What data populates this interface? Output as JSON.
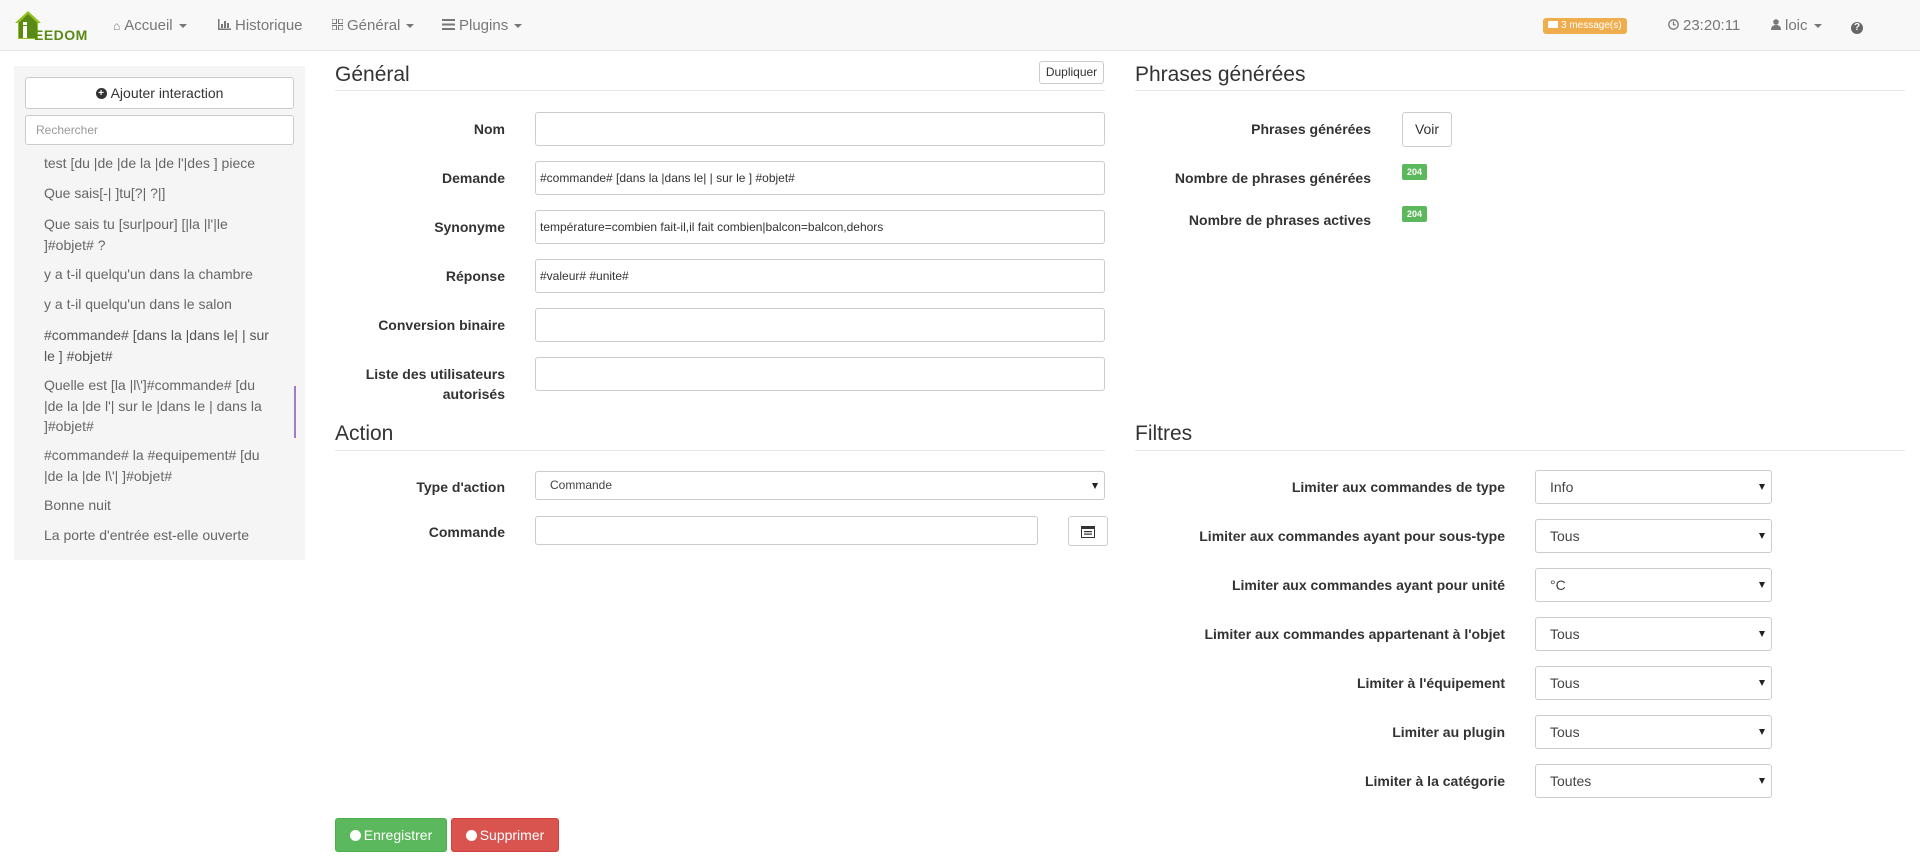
{
  "navbar": {
    "logo_text": "EEDOM",
    "items": [
      {
        "label": "Accueil",
        "icon": "home-icon"
      },
      {
        "label": "Historique",
        "icon": "bar-chart-icon"
      },
      {
        "label": "Général",
        "icon": "grid-icon"
      },
      {
        "label": "Plugins",
        "icon": "list-icon"
      }
    ],
    "messages_badge": "3 message(s)",
    "time": "23:20:11",
    "user": "loic",
    "help_icon": "question-icon"
  },
  "sidebar": {
    "add_button": "Ajouter interaction",
    "search_placeholder": "Rechercher",
    "items": [
      "test [du |de |de la |de l'|des ] piece",
      "Que sais[-| ]tu[?| ?|]",
      "Que sais tu [sur|pour] [|la |l'|le ]#objet# ?",
      "y a t-il quelqu'un dans la chambre",
      "y a t-il quelqu'un dans le salon",
      "#commande# [dans la |dans le| | sur le ] #objet#",
      "Quelle est [la |l\\']#commande# [du |de la |de l'| sur le |dans le | dans la ]#objet#",
      "#commande# la #equipement# [du |de la |de l\\'| ]#objet#",
      "Bonne nuit",
      "La porte d'entrée est-elle ouverte"
    ]
  },
  "general": {
    "title": "Général",
    "duplicate_button": "Dupliquer",
    "fields": [
      {
        "label": "Nom",
        "value": ""
      },
      {
        "label": "Demande",
        "value": "#commande# [dans la |dans le| | sur le ] #objet#"
      },
      {
        "label": "Synonyme",
        "value": "température=combien fait-il,il fait combien|balcon=balcon,dehors"
      },
      {
        "label": "Réponse",
        "value": "#valeur# #unite#"
      },
      {
        "label": "Conversion binaire",
        "value": ""
      },
      {
        "label": "Liste des utilisateurs autorisés",
        "value": ""
      }
    ]
  },
  "phrases": {
    "title": "Phrases générées",
    "generated_label": "Phrases générées",
    "view_button": "Voir",
    "count_label": "Nombre de phrases générées",
    "count_value": "204",
    "active_label": "Nombre de phrases actives",
    "active_value": "204"
  },
  "action": {
    "title": "Action",
    "type_label": "Type d'action",
    "type_value": "Commande",
    "command_label": "Commande",
    "command_value": ""
  },
  "filters": {
    "title": "Filtres",
    "rows": [
      {
        "label": "Limiter aux commandes de type",
        "value": "Info"
      },
      {
        "label": "Limiter aux commandes ayant pour sous-type",
        "value": "Tous"
      },
      {
        "label": "Limiter aux commandes ayant pour unité",
        "value": "°C"
      },
      {
        "label": "Limiter aux commandes appartenant à l'objet",
        "value": "Tous"
      },
      {
        "label": "Limiter à l'équipement",
        "value": "Tous"
      },
      {
        "label": "Limiter au plugin",
        "value": "Tous"
      },
      {
        "label": "Limiter à la catégorie",
        "value": "Toutes"
      }
    ]
  },
  "buttons": {
    "save": "Enregistrer",
    "delete": "Supprimer"
  },
  "colors": {
    "accent_green": "#5cb85c",
    "danger_red": "#d9534f",
    "warning_orange": "#f0ad4e",
    "active_marker": "#a07dc7"
  }
}
